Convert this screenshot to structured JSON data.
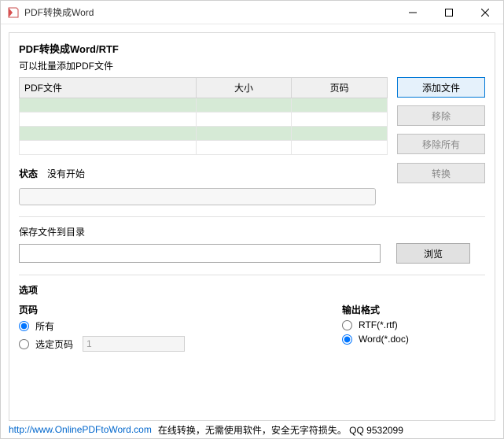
{
  "window": {
    "title": "PDF转换成Word"
  },
  "panel": {
    "heading": "PDF转换成Word/RTF",
    "subheading": "可以批量添加PDF文件"
  },
  "table": {
    "headers": {
      "file": "PDF文件",
      "size": "大小",
      "pages": "页码"
    }
  },
  "buttons": {
    "add": "添加文件",
    "remove": "移除",
    "removeAll": "移除所有",
    "convert": "转换",
    "browse": "浏览"
  },
  "status": {
    "label": "状态",
    "text": "没有开始"
  },
  "save": {
    "label": "保存文件到目录",
    "value": ""
  },
  "options": {
    "title": "选项",
    "pages": {
      "title": "页码",
      "all": "所有",
      "selected": "选定页码",
      "selectedValue": "1"
    },
    "format": {
      "title": "输出格式",
      "rtf": "RTF(*.rtf)",
      "word": "Word(*.doc)"
    }
  },
  "footer": {
    "url": "http://www.OnlinePDFtoWord.com",
    "text": "在线转换，无需使用软件，安全无字符损失。 QQ 9532099"
  }
}
